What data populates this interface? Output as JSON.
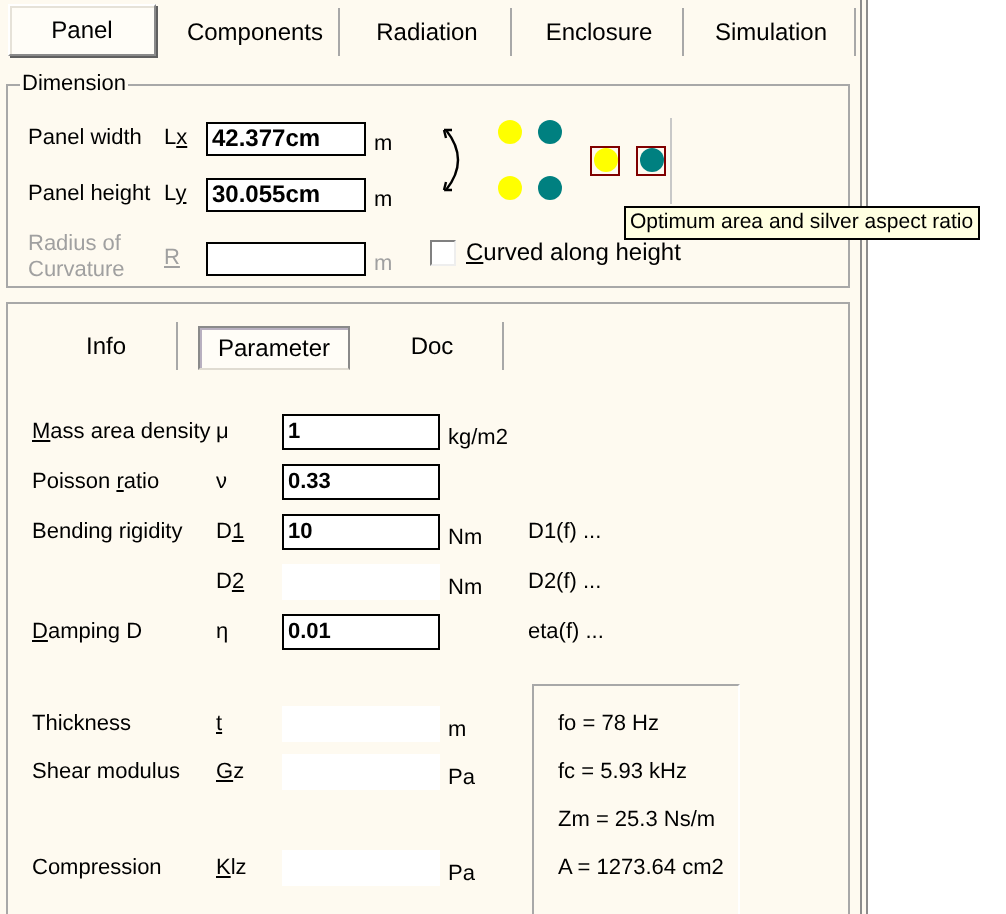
{
  "tabs": [
    {
      "label": "Panel",
      "selected": true
    },
    {
      "label": "Components",
      "selected": false
    },
    {
      "label": "Radiation",
      "selected": false
    },
    {
      "label": "Enclosure",
      "selected": false
    },
    {
      "label": "Simulation",
      "selected": false
    }
  ],
  "dimension": {
    "legend": "Dimension",
    "rows": [
      {
        "label": "Panel width",
        "symbol": {
          "pre": "L",
          "key": "x"
        },
        "value": "42.377cm",
        "unit": "m",
        "disabled": false
      },
      {
        "label": "Panel height",
        "symbol": {
          "pre": "L",
          "key": "y"
        },
        "value": "30.055cm",
        "unit": "m",
        "disabled": false
      },
      {
        "label": "Radius of Curvature",
        "symbol": {
          "key": "R"
        },
        "unit": "m",
        "disabled": true
      }
    ],
    "dots": [
      {
        "color": "#ffff00"
      },
      {
        "color": "#008080"
      },
      {
        "color": "#ffff00"
      },
      {
        "color": "#008080"
      }
    ],
    "swatch_buttons": [
      {
        "color": "#ffff00"
      },
      {
        "color": "#008080"
      }
    ],
    "checkbox": {
      "label": {
        "key": "C",
        "post": "urved along height"
      },
      "checked": false
    }
  },
  "tooltip": "Optimum area and silver aspect ratio",
  "subtabs": [
    {
      "label": "Info",
      "selected": false
    },
    {
      "label": "Parameter",
      "selected": true
    },
    {
      "label": "Doc",
      "selected": false
    }
  ],
  "parameters": [
    {
      "label": {
        "key": "M",
        "post": "ass area density"
      },
      "symbol": {
        "pre": "μ"
      },
      "value": "1",
      "unit": "kg/m2",
      "editable": true
    },
    {
      "label": {
        "pre": "Poisson ",
        "key": "r",
        "post": "atio"
      },
      "symbol": {
        "pre": "ν"
      },
      "value": "0.33",
      "editable": true
    },
    {
      "label": {
        "pre": "Bending rigidity"
      },
      "symbol": {
        "pre": "D",
        "key": "1"
      },
      "value": "10",
      "unit": "Nm",
      "editable": true,
      "link": "D1(f) ..."
    },
    {
      "symbol": {
        "pre": "D",
        "key": "2"
      },
      "unit": "Nm",
      "editable": false,
      "link": "D2(f) ..."
    },
    {
      "label": {
        "key": "D",
        "post": "amping D"
      },
      "symbol": {
        "pre": "η"
      },
      "value": "0.01",
      "editable": true,
      "link": "eta(f) ..."
    }
  ],
  "layer_groups": [
    [
      {
        "label": {
          "pre": "Thickness"
        },
        "symbol": {
          "key": "t"
        },
        "unit": "m"
      },
      {
        "label": {
          "pre": "Shear modulus"
        },
        "symbol": {
          "key": "G",
          "post": "z"
        },
        "unit": "Pa"
      }
    ],
    [
      {
        "label": {
          "pre": "Compression"
        },
        "symbol": {
          "key": "K",
          "post": "lz"
        },
        "unit": "Pa"
      }
    ]
  ],
  "results": [
    "fo = 78 Hz",
    "fc = 5.93 kHz",
    "Zm = 25.3 Ns/m",
    "A = 1273.64 cm2"
  ]
}
